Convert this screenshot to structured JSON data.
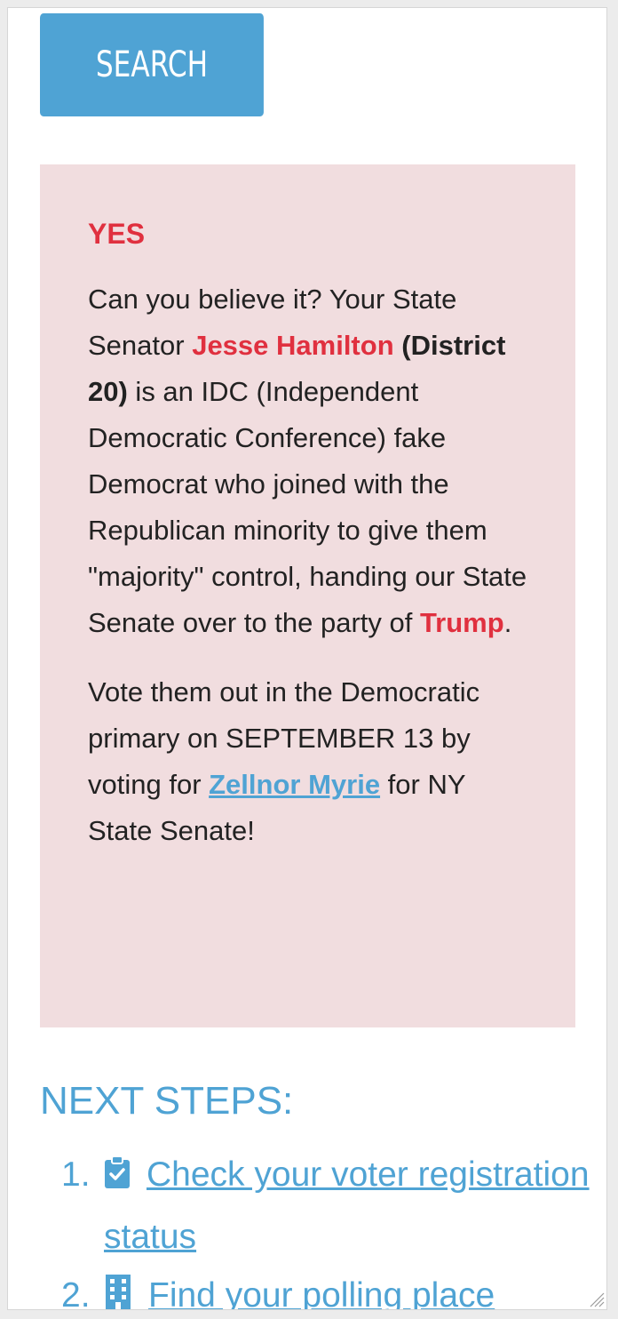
{
  "search": {
    "label": "SEARCH"
  },
  "result": {
    "answer": "YES",
    "para1": {
      "t1": "Can you believe it? Your State Senator ",
      "senator_name": "Jesse Hamilton",
      "t2": " ",
      "district": "(District 20)",
      "t3": " is an IDC (Independent Democratic Conference) fake Democrat who joined with the Republican minority to give them \"majority\" control, handing our State Senate over to the party of ",
      "party_leader": "Trump",
      "t4": "."
    },
    "para2": {
      "t1": "Vote them out in the Democratic primary on SEPTEMBER 13 by voting for ",
      "candidate": "Zellnor Myrie",
      "t2": " for NY State Senate!"
    }
  },
  "next_steps": {
    "title": "NEXT STEPS:",
    "items": [
      {
        "number": "1.",
        "icon": "clipboard-check-icon",
        "label": "Check your voter registration status"
      },
      {
        "number": "2.",
        "icon": "building-icon",
        "label": "Find your polling place"
      }
    ]
  },
  "colors": {
    "accent": "#4fa3d4",
    "alert_red": "#e0303f",
    "result_bg": "#f1dddf",
    "text": "#222222"
  }
}
